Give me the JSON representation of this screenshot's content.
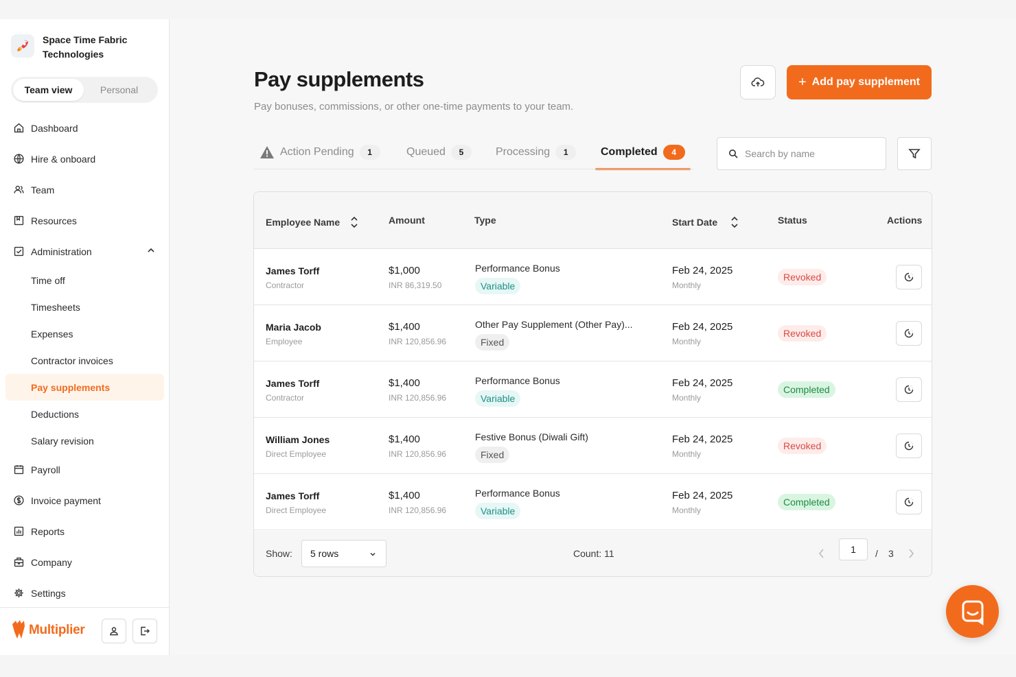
{
  "org": {
    "name": "Space Time Fabric Technologies"
  },
  "view_toggle": {
    "team": "Team view",
    "personal": "Personal"
  },
  "nav": {
    "dashboard": "Dashboard",
    "hire": "Hire & onboard",
    "team": "Team",
    "resources": "Resources",
    "administration": "Administration",
    "sub": [
      "Time off",
      "Timesheets",
      "Expenses",
      "Contractor invoices",
      "Pay supplements",
      "Deductions",
      "Salary revision"
    ],
    "payroll": "Payroll",
    "invoice_payment": "Invoice payment",
    "reports": "Reports",
    "company": "Company",
    "settings": "Settings"
  },
  "brand": {
    "name": "Multiplier"
  },
  "page": {
    "title": "Pay supplements",
    "subtitle": "Pay bonuses, commissions, or other one-time payments to your team.",
    "add_button": "Add pay supplement"
  },
  "tabs": [
    {
      "label": "Action Pending",
      "count": "1"
    },
    {
      "label": "Queued",
      "count": "5"
    },
    {
      "label": "Processing",
      "count": "1"
    },
    {
      "label": "Completed",
      "count": "4"
    }
  ],
  "search": {
    "placeholder": "Search by name"
  },
  "table": {
    "headers": {
      "employee": "Employee Name",
      "amount": "Amount",
      "type": "Type",
      "start_date": "Start Date",
      "status": "Status",
      "actions": "Actions"
    },
    "rows": [
      {
        "name": "James Torff",
        "role": "Contractor",
        "amount": "$1,000",
        "amount_local": "INR 86,319.50",
        "type": "Performance Bonus",
        "tag": "Variable",
        "date": "Feb 24, 2025",
        "frequency": "Monthly",
        "status": "Revoked"
      },
      {
        "name": "Maria Jacob",
        "role": "Employee",
        "amount": "$1,400",
        "amount_local": "INR 120,856.96",
        "type": "Other Pay Supplement (Other Pay)...",
        "tag": "Fixed",
        "date": "Feb 24, 2025",
        "frequency": "Monthly",
        "status": "Revoked"
      },
      {
        "name": "James Torff",
        "role": "Contractor",
        "amount": "$1,400",
        "amount_local": "INR 120,856.96",
        "type": "Performance Bonus",
        "tag": "Variable",
        "date": "Feb 24, 2025",
        "frequency": "Monthly",
        "status": "Completed"
      },
      {
        "name": "William Jones",
        "role": "Direct Employee",
        "amount": "$1,400",
        "amount_local": "INR 120,856.96",
        "type": "Festive Bonus (Diwali Gift)",
        "tag": "Fixed",
        "date": "Feb 24, 2025",
        "frequency": "Monthly",
        "status": "Revoked"
      },
      {
        "name": "James Torff",
        "role": "Direct Employee",
        "amount": "$1,400",
        "amount_local": "INR 120,856.96",
        "type": "Performance Bonus",
        "tag": "Variable",
        "date": "Feb 24, 2025",
        "frequency": "Monthly",
        "status": "Completed"
      }
    ]
  },
  "footer": {
    "show_label": "Show:",
    "rows_option": "5 rows",
    "count": "Count: 11",
    "current_page": "1",
    "separator": "/",
    "total_pages": "3"
  },
  "colors": {
    "accent": "#f26b1d"
  },
  "icons": {
    "upload": "cloud-upload-icon",
    "filter": "filter-icon",
    "search": "search-icon",
    "chat": "chat-icon"
  }
}
